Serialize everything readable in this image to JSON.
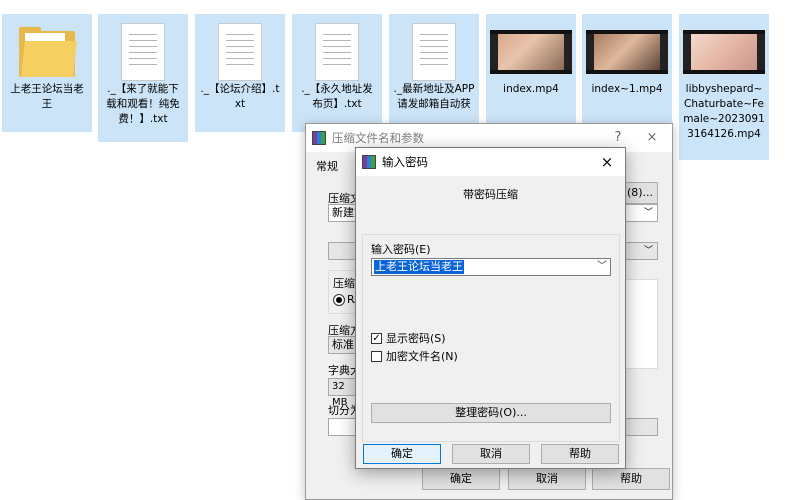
{
  "files": [
    {
      "type": "folder",
      "name": "上老王论坛当老王"
    },
    {
      "type": "text",
      "name": "._【来了就能下载和观看！纯免费！】.txt"
    },
    {
      "type": "text",
      "name": "._【论坛介绍】.txt"
    },
    {
      "type": "text",
      "name": "._【永久地址发布页】.txt"
    },
    {
      "type": "text",
      "name": "._最新地址及APP请发邮箱自动获"
    },
    {
      "type": "video",
      "name": "index.mp4"
    },
    {
      "type": "video",
      "name": "index~1.mp4"
    },
    {
      "type": "video",
      "name": "libbyshepard~Chaturbate~Female~20230913164126.mp4"
    }
  ],
  "back_dialog": {
    "title": "压缩文件名和参数",
    "help_label": "?",
    "close_label": "×",
    "tab_general": "常规",
    "archive_name_label": "压缩文",
    "browse_label": "(8)...",
    "archive_name_value": "新建文",
    "format_label": "压缩",
    "format_radio": "RA",
    "method_label": "压缩方",
    "method_value": "标准",
    "dict_label": "字典大",
    "dict_value": "32 MB",
    "split_label": "切分为",
    "ok": "确定",
    "cancel": "取消",
    "help": "帮助"
  },
  "front_dialog": {
    "title": "输入密码",
    "close_label": "×",
    "caption": "带密码压缩",
    "password_label": "输入密码(E)",
    "password_value": "上老王论坛当老王",
    "show_password": "显示密码(S)",
    "show_password_checked": true,
    "encrypt_names": "加密文件名(N)",
    "encrypt_names_checked": false,
    "manage_button": "整理密码(O)...",
    "ok": "确定",
    "cancel": "取消",
    "help": "帮助"
  },
  "colors": {
    "selection_bg": "#cce4f7",
    "highlight": "#0a64d8"
  }
}
